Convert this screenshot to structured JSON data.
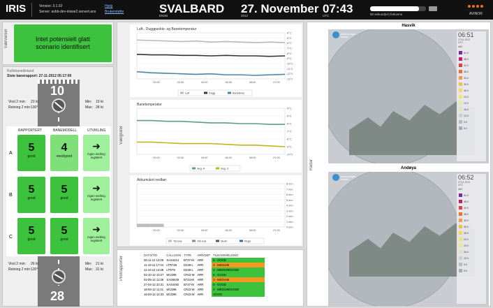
{
  "header": {
    "app_name": "IRIS",
    "version_label": "Version: 3.1.02",
    "server_label": "Server: avbb-dev-iriswe2.servert.ans",
    "help_links": [
      "Hjelp",
      "Brukerstøtte"
    ],
    "airport": "SVALBARD",
    "airport_code": "ENSB",
    "date": "27. November",
    "year": "2012",
    "time": "07:43",
    "timezone": "UTC",
    "refresh_label": "50 sekund(er) frekvens",
    "refresh_fraction": 0.88,
    "brand": "AVINOR",
    "colors": {
      "accent": "#e8731a"
    }
  },
  "left": {
    "section_label": "Værvarsel",
    "alert_text": "Intet potensielt glatt scenario identifisert",
    "runway_status_label": "Rullebanetilstand",
    "report_label": "Siste banerapport: 27-11-2012 05:17:00",
    "rwy_top": "10",
    "rwy_bottom": "28",
    "wind_top": {
      "wind_label": "Vind 2 min:",
      "wind_value": "23 kt",
      "dir_label": "Retning 2 min:",
      "dir_value": "130°",
      "min_label": "Min:",
      "min_value": "19 kt",
      "max_label": "Max:",
      "max_value": "28 kt"
    },
    "wind_bottom": {
      "wind_label": "Vind 2 min:",
      "wind_value": "26 kt",
      "dir_label": "Retning 2 min:",
      "dir_value": "120°",
      "min_label": "Min:",
      "min_value": "21 kt",
      "max_label": "Max:",
      "max_value": "31 kt"
    },
    "columns": [
      "RAPPORTERT",
      "BANEMODELL",
      "UTVIKLING"
    ],
    "rows": [
      {
        "label": "A",
        "reported": {
          "value": "5",
          "text": "good"
        },
        "model": {
          "value": "4",
          "text": "med/good"
        },
        "trend": "ingen endring registrert"
      },
      {
        "label": "B",
        "reported": {
          "value": "5",
          "text": "good"
        },
        "model": {
          "value": "5",
          "text": "good"
        },
        "trend": "ingen endring registrert"
      },
      {
        "label": "C",
        "reported": {
          "value": "5",
          "text": "good"
        },
        "model": {
          "value": "5",
          "text": "good"
        },
        "trend": "ingen endring registrert"
      }
    ],
    "arrow": "➜"
  },
  "middle": {
    "section_label": "Værgrafer",
    "pilot_label": "Pilotrapporter",
    "charts": [
      {
        "type": "line",
        "title": "Luft-, Duggpunkts- og Banetemperatur",
        "x": [
          "00:00",
          "02:00",
          "04:00",
          "06:00",
          "08:00",
          "07:00"
        ],
        "y_ticks": [
          "-4°C",
          "-5°C",
          "-6°C",
          "-7°C",
          "-8°C",
          "-9°C",
          "-10°C",
          "-11°C",
          "-12°C",
          "-13°C"
        ],
        "ylim": [
          -13,
          -4
        ],
        "series": [
          {
            "name": "Luft",
            "color": "#b9b9b9",
            "values": [
              -5.4,
              -5.5,
              -5.6,
              -5.7,
              -5.6,
              -5.8,
              -5.7,
              -5.8,
              -5.9,
              -5.8,
              -5.9
            ]
          },
          {
            "name": "Dugg",
            "color": "#333333",
            "values": [
              -8.2,
              -8.3,
              -8.3,
              -8.4,
              -8.4,
              -8.5,
              -8.4,
              -8.5,
              -8.5,
              -8.6,
              -8.5
            ]
          },
          {
            "name": "Banetemp",
            "color": "#4a86a8",
            "values": [
              -11.6,
              -11.8,
              -11.9,
              -12.0,
              -12.1,
              -12.0,
              -12.2,
              -12.2,
              -12.3,
              -12.2,
              -12.1
            ]
          }
        ],
        "legend": "bottom"
      },
      {
        "type": "line",
        "title": "Banetemperatur",
        "x": [
          "00:00",
          "02:00",
          "04:00",
          "06:00",
          "08:00",
          "07:00"
        ],
        "y_ticks": [
          "-4°C",
          "-5°C",
          "-6°C",
          "-7°C",
          "-8°C",
          "-9°C",
          "-10°C"
        ],
        "ylim": [
          -10,
          -4
        ],
        "series": [
          {
            "name": "Seg. A",
            "color": "#5f9d86",
            "values": [
              -5.6,
              -5.6,
              -5.7,
              -5.7,
              -5.8,
              -5.9,
              -5.9,
              -6.0,
              -6.0,
              -6.1,
              -6.1
            ]
          },
          {
            "name": "Seg. C",
            "color": "#c4b51c",
            "values": [
              -8.4,
              -8.4,
              -8.5,
              -8.6,
              -8.6,
              -8.6,
              -8.7,
              -8.8,
              -8.8,
              -8.9,
              -9.0
            ]
          }
        ],
        "legend": "bottom"
      },
      {
        "type": "bar",
        "title": "Akkumulert nedbør",
        "x": [
          "00:00",
          "02:00",
          "04:00",
          "06:00",
          "08:00",
          "07:00"
        ],
        "y_ticks": [
          "8 mm",
          "7 mm",
          "6 mm",
          "5 mm",
          "4 mm",
          "3 mm",
          "2 mm",
          "1 mm",
          "0 mm"
        ],
        "ylim": [
          0,
          8
        ],
        "series": [
          {
            "name": "Tot.snø",
            "color": "#bdbdbd",
            "values": [
              0.6,
              0.6,
              0,
              0,
              0,
              0,
              0,
              0,
              0,
              0,
              0
            ]
          },
          {
            "name": "Våt snø",
            "color": "#888888",
            "values": [
              0,
              0,
              0,
              0,
              0,
              0,
              0,
              0,
              0,
              0,
              0
            ]
          },
          {
            "name": "Slush",
            "color": "#555555",
            "values": [
              0,
              0,
              0,
              0,
              0,
              0,
              0,
              0,
              0,
              0,
              0
            ]
          },
          {
            "name": "Regn",
            "color": "#2f6ea5",
            "values": [
              0,
              0,
              0,
              0,
              0,
              0,
              0,
              0,
              0,
              0,
              0
            ]
          }
        ],
        "legend": "bottom"
      }
    ],
    "pirep": {
      "headers": [
        "DATO/TID",
        "CALLSIGN",
        "TYPE",
        "ARR/DEP",
        "TILBAKEMELDING"
      ],
      "rows": [
        {
          "date": "26-11-12 12:06",
          "callsign": "SAS4414",
          "type": "B737-M",
          "arrdep": "ARR",
          "feedback": "5 - GOOD",
          "color": "#3cc23c"
        },
        {
          "date": "11-10-12 17:44",
          "callsign": "LTR728",
          "type": "D228-L",
          "arrdep": "ARR",
          "feedback": "3 - MEDIUM",
          "color": "#f29a1f"
        },
        {
          "date": "11-10-12 14:38",
          "callsign": "LTR79",
          "type": "D228-L",
          "arrdep": "ARR",
          "feedback": "4 - MEDIUM/GOOD",
          "color": "#3cc23c"
        },
        {
          "date": "02-10-12 10:27",
          "callsign": "WIJ296",
          "type": "CRJ2-M",
          "arrdep": "ARR",
          "feedback": "5 - GOOD",
          "color": "#3cc23c"
        },
        {
          "date": "02-05-12 11:39",
          "callsign": "SAS6629",
          "type": "B734-M",
          "arrdep": "ARR",
          "feedback": "3 - MEDIUM",
          "color": "#f29a1f"
        },
        {
          "date": "27-04-12 22:31",
          "callsign": "SAS4492",
          "type": "B737-M",
          "arrdep": "ARR",
          "feedback": "5 - GOOD",
          "color": "#3cc23c"
        },
        {
          "date": "18-03-12 11:41",
          "callsign": "WIJ296",
          "type": "CRJ2-M",
          "arrdep": "ARR",
          "feedback": "4 - MEDIUM/GOOD",
          "color": "#3cc23c"
        },
        {
          "date": "16-03-12 14:33",
          "callsign": "WIJ296",
          "type": "CRJ2-M",
          "arrdep": "ARR",
          "feedback": "GOOD",
          "color": "#3cc23c"
        }
      ]
    }
  },
  "right": {
    "section_label": "Radar",
    "radars": [
      {
        "title": "Hasvik",
        "time": "06:51",
        "date": "27/11 2012",
        "tz": "UTC",
        "unit": "dBZ",
        "logo_text": "meteorologisk institutt"
      },
      {
        "title": "Andøya",
        "time": "06:52",
        "date": "27/11 2012",
        "tz": "UTC",
        "unit": "dBZ",
        "logo_text": "meteorologisk institutt"
      }
    ],
    "scale": [
      "61.0",
      "48.0",
      "42.0",
      "38.0",
      "33.0",
      "30.0",
      "26.0",
      "23.0",
      "19.0",
      "16.0",
      "12.0",
      "9.0",
      "5.0"
    ],
    "scale_colors": [
      "#7a1fa2",
      "#c2185b",
      "#e53935",
      "#f06a2a",
      "#f39c3d",
      "#f5c243",
      "#f6dd54",
      "#f3e96a",
      "#efef90",
      "#e6e6b8",
      "#cfd3d8",
      "#b8bcc4",
      "#a9aeb6"
    ]
  }
}
